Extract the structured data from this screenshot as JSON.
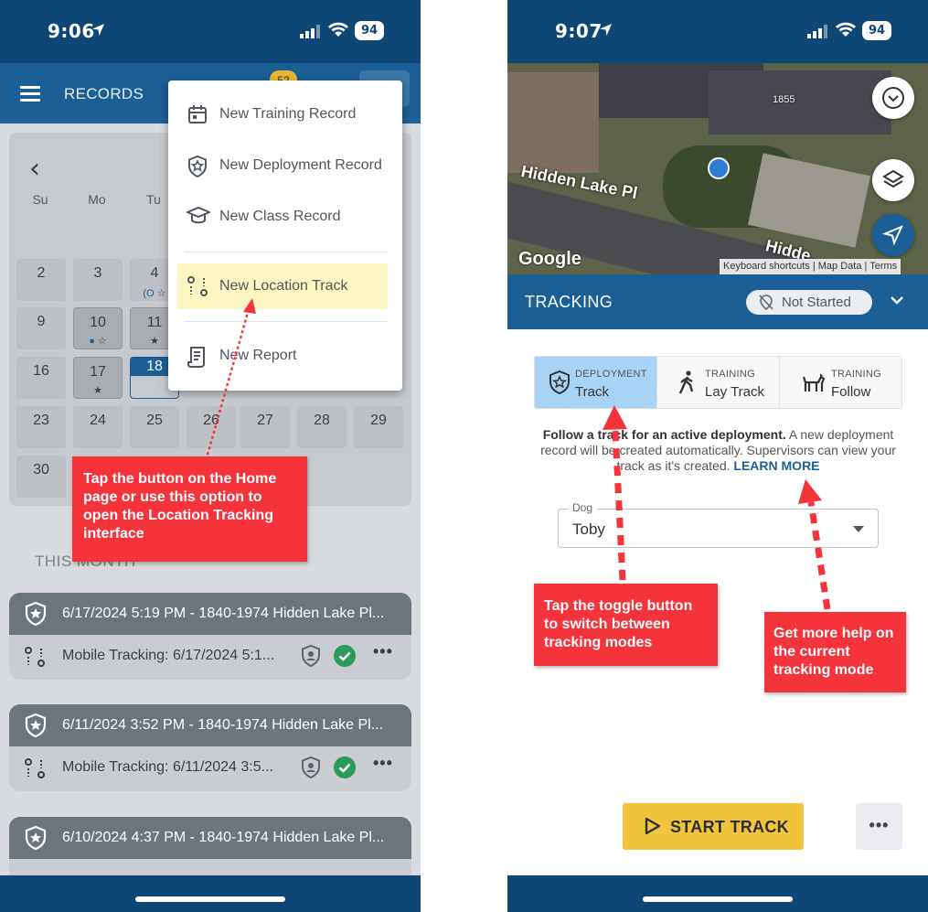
{
  "left": {
    "status": {
      "time": "9:06",
      "battery": "94"
    },
    "header": {
      "title": "RECORDS",
      "badge": "52"
    },
    "calendar": {
      "weekdays": [
        "Su",
        "Mo",
        "Tu"
      ],
      "days": [
        "2",
        "3",
        "4",
        "9",
        "10",
        "11",
        "16",
        "17",
        "18",
        "23",
        "24",
        "25",
        "26",
        "27",
        "28",
        "29",
        "30"
      ]
    },
    "menu": {
      "items": [
        "New Training Record",
        "New Deployment Record",
        "New Class Record",
        "New Location Track",
        "New Report"
      ]
    },
    "callout": "Tap the button on the Home page or use this option to open the Location Tracking interface",
    "month_label": "THIS MONTH",
    "records": [
      {
        "title": "6/17/2024 5:19 PM - 1840-1974 Hidden Lake Pl...",
        "sub": "Mobile Tracking: 6/17/2024 5:1..."
      },
      {
        "title": "6/11/2024 3:52 PM - 1840-1974 Hidden Lake Pl...",
        "sub": "Mobile Tracking: 6/11/2024 3:5..."
      },
      {
        "title": "6/10/2024 4:37 PM - 1840-1974 Hidden Lake Pl..."
      }
    ],
    "more": "•••"
  },
  "right": {
    "status": {
      "time": "9:07",
      "battery": "94"
    },
    "map": {
      "street": "Hidden Lake Pl",
      "street2": "Hidde",
      "house_number": "1855",
      "google": "Google",
      "attribution": "Keyboard shortcuts | Map Data | Terms"
    },
    "tracking": {
      "title": "TRACKING",
      "status": "Not Started"
    },
    "modes": [
      {
        "small": "DEPLOYMENT",
        "big": "Track"
      },
      {
        "small": "TRAINING",
        "big": "Lay Track"
      },
      {
        "small": "TRAINING",
        "big": "Follow"
      }
    ],
    "description": {
      "bold": "Follow a track for an active deployment.",
      "rest": " A new deployment record will be created automatically. Supervisors can view your track as it's created. ",
      "link": "LEARN MORE"
    },
    "dog": {
      "label": "Dog",
      "value": "Toby"
    },
    "callout_toggle": "Tap the toggle button to switch between tracking modes",
    "callout_help": "Get more help on the current tracking mode",
    "start_label": "START TRACK",
    "more": "•••"
  },
  "colors": {
    "navy": "#0e4675",
    "primary": "#1c5f96",
    "callout": "#f4333b",
    "start": "#f2c43c",
    "active_toggle": "#a8d3f6",
    "menu_highlight": "#fbf6c2",
    "success": "#2c9a58"
  }
}
